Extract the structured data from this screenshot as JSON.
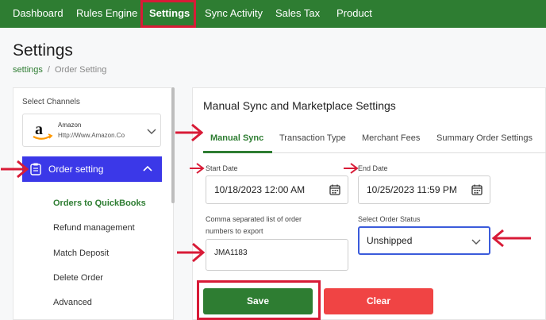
{
  "nav": {
    "items": [
      {
        "label": "Dashboard",
        "active": false
      },
      {
        "label": "Rules Engine",
        "active": false
      },
      {
        "label": "Settings",
        "active": true
      },
      {
        "label": "Sync Activity",
        "active": false
      },
      {
        "label": "Sales Tax",
        "active": false
      },
      {
        "label": "Product",
        "active": false
      }
    ]
  },
  "header": {
    "title": "Settings",
    "breadcrumb": {
      "link": "settings",
      "separator": "/",
      "current": "Order Setting"
    }
  },
  "sidebar": {
    "channels_label": "Select Channels",
    "channel": {
      "name": "Amazon",
      "url": "Http://Www.Amazon.Co",
      "icon": "amazon-logo"
    },
    "order_setting_label": "Order setting",
    "sub_items": [
      {
        "label": "Orders to QuickBooks",
        "active": true
      },
      {
        "label": "Refund management",
        "active": false
      },
      {
        "label": "Match Deposit",
        "active": false
      },
      {
        "label": "Delete Order",
        "active": false
      },
      {
        "label": "Advanced",
        "active": false
      }
    ]
  },
  "main": {
    "title": "Manual Sync and Marketplace Settings",
    "tabs": [
      {
        "label": "Manual Sync",
        "active": true
      },
      {
        "label": "Transaction Type",
        "active": false
      },
      {
        "label": "Merchant Fees",
        "active": false
      },
      {
        "label": "Summary Order Settings",
        "active": false
      }
    ],
    "start_date": {
      "label": "Start Date",
      "value": "10/18/2023 12:00 AM"
    },
    "end_date": {
      "label": "End Date",
      "value": "10/25/2023 11:59 PM"
    },
    "order_numbers": {
      "label_line1": "Comma separated list of order",
      "label_line2": "numbers to export",
      "value": "JMA1183"
    },
    "order_status": {
      "label": "Select Order Status",
      "value": "Unshipped"
    },
    "save_label": "Save",
    "clear_label": "Clear"
  },
  "colors": {
    "nav_bg": "#2e7d32",
    "accent_green": "#2e7d32",
    "order_setting_bg": "#3b38e8",
    "clear_btn": "#f04444",
    "annotation_red": "#d81b37"
  }
}
